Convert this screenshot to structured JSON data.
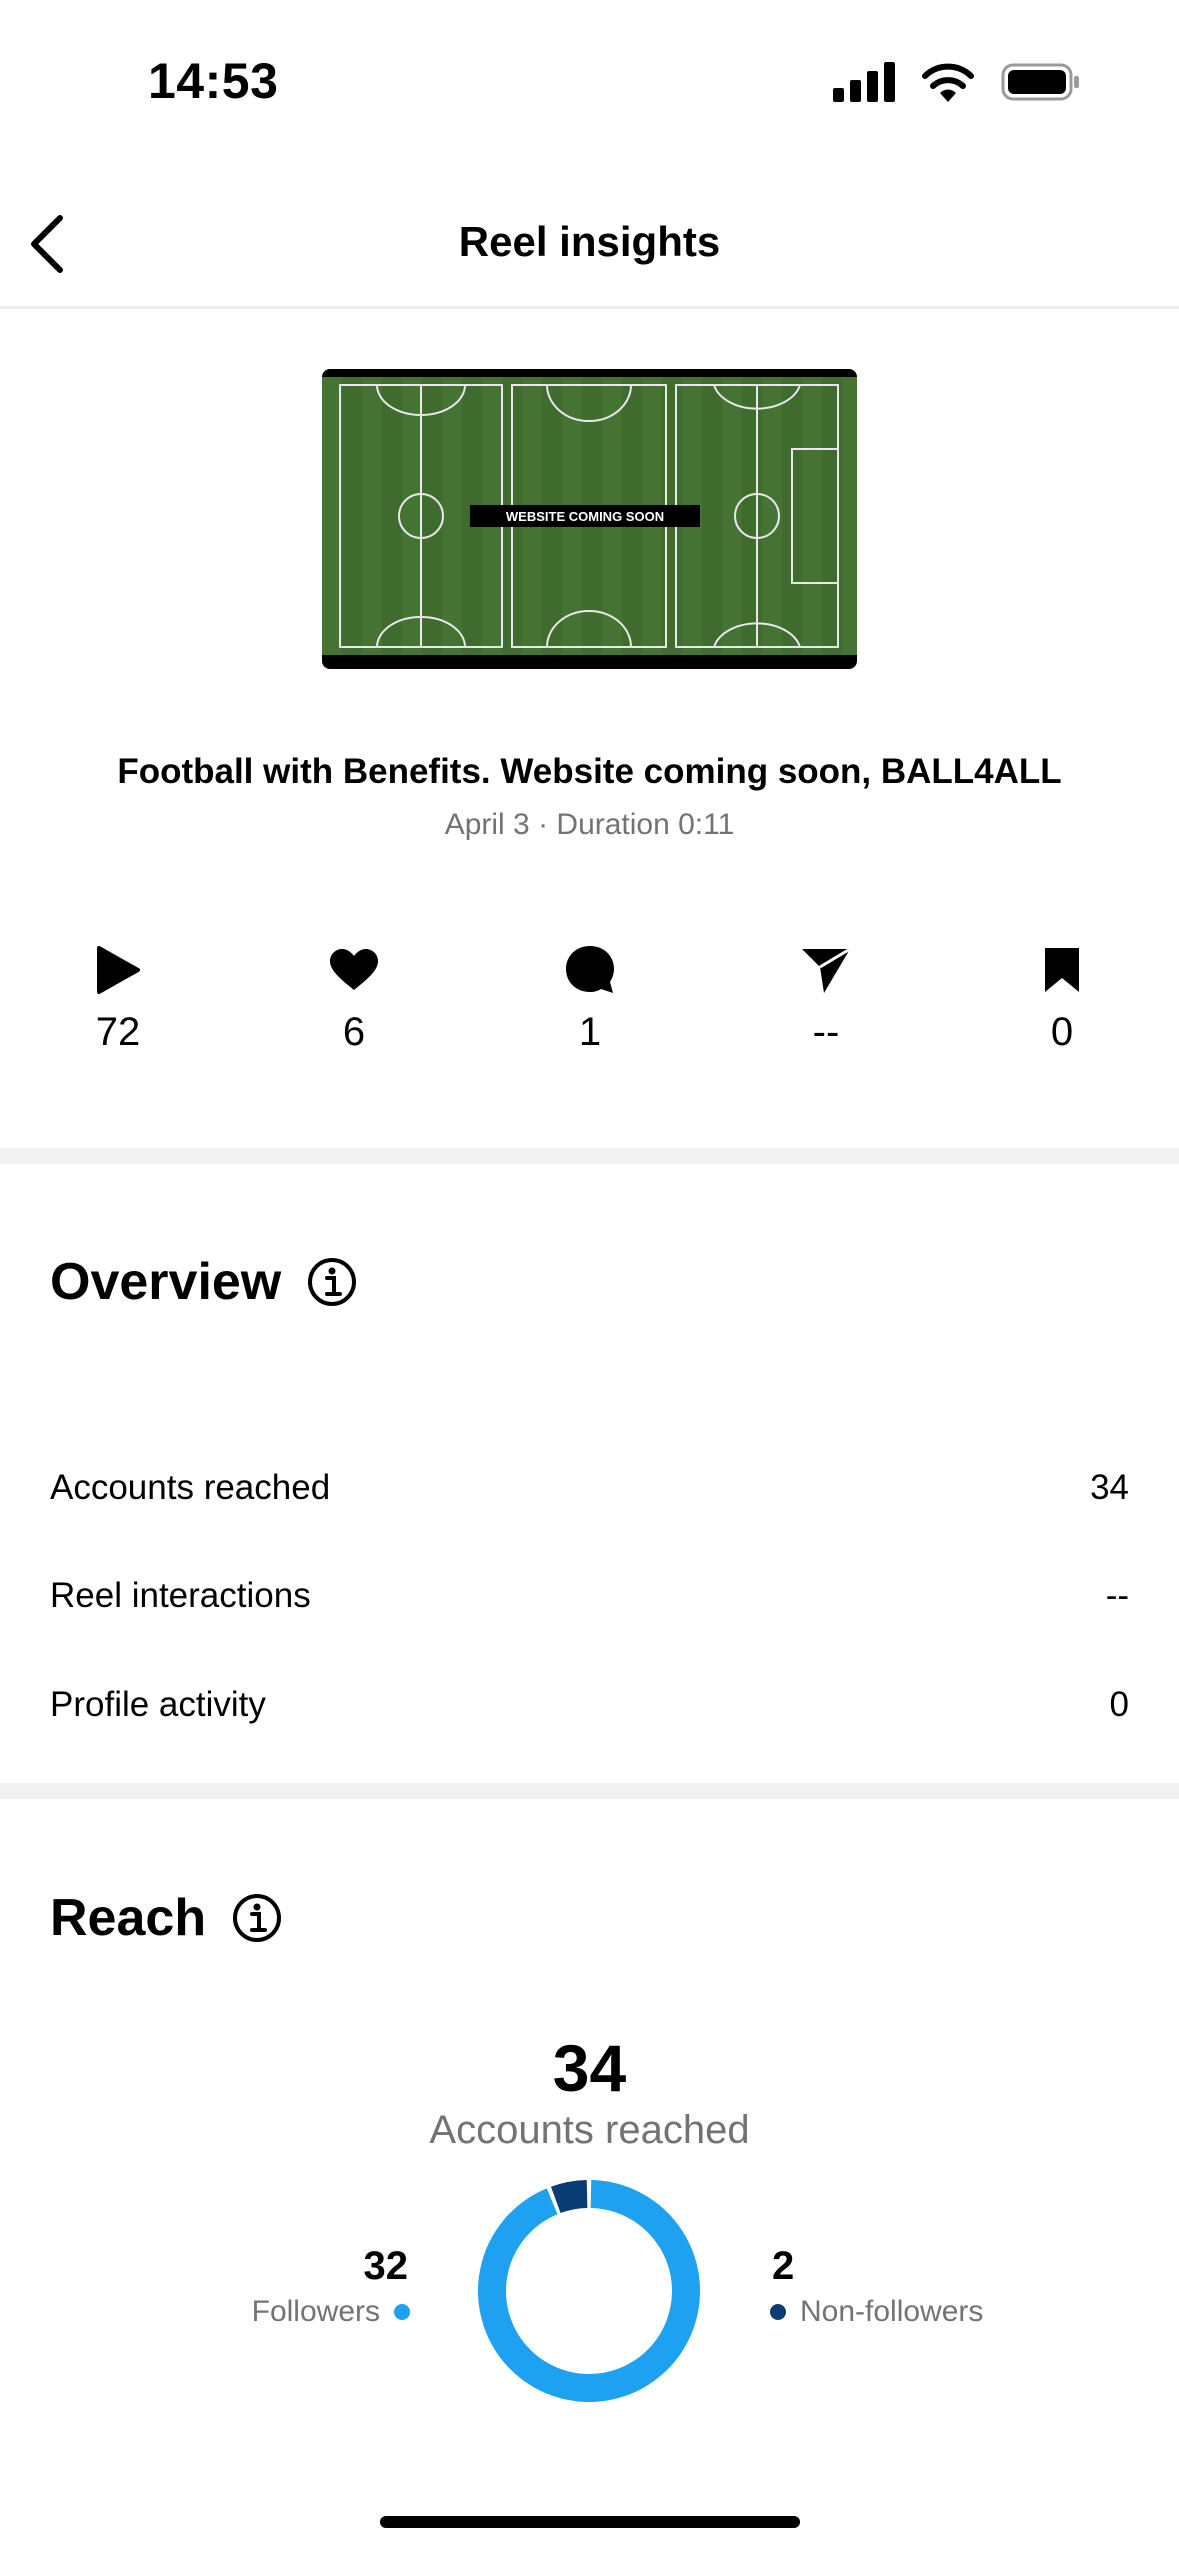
{
  "status": {
    "time": "14:53"
  },
  "header": {
    "title": "Reel insights"
  },
  "reel": {
    "thumbnail_overlay": "WEBSITE COMING SOON",
    "title": "Football with Benefits. Website coming soon, BALL4ALL",
    "meta": "April 3 · Duration 0:11"
  },
  "metrics": {
    "plays": "72",
    "likes": "6",
    "comments": "1",
    "shares": "--",
    "saves": "0"
  },
  "overview": {
    "title": "Overview",
    "rows": [
      {
        "label": "Accounts reached",
        "value": "34"
      },
      {
        "label": "Reel interactions",
        "value": "--"
      },
      {
        "label": "Profile activity",
        "value": "0"
      }
    ]
  },
  "reach": {
    "title": "Reach",
    "total": "34",
    "total_label": "Accounts reached",
    "followers": {
      "count": "32",
      "label": "Followers",
      "color": "#1fa1f1"
    },
    "non_followers": {
      "count": "2",
      "label": "Non-followers",
      "color": "#0a3d73"
    },
    "donut_values": [
      32,
      2
    ]
  },
  "icons": {
    "plays": "play-icon",
    "likes": "heart-icon",
    "comments": "comment-icon",
    "shares": "send-icon",
    "saves": "bookmark-icon",
    "info": "info-icon",
    "back": "chevron-left-icon"
  }
}
